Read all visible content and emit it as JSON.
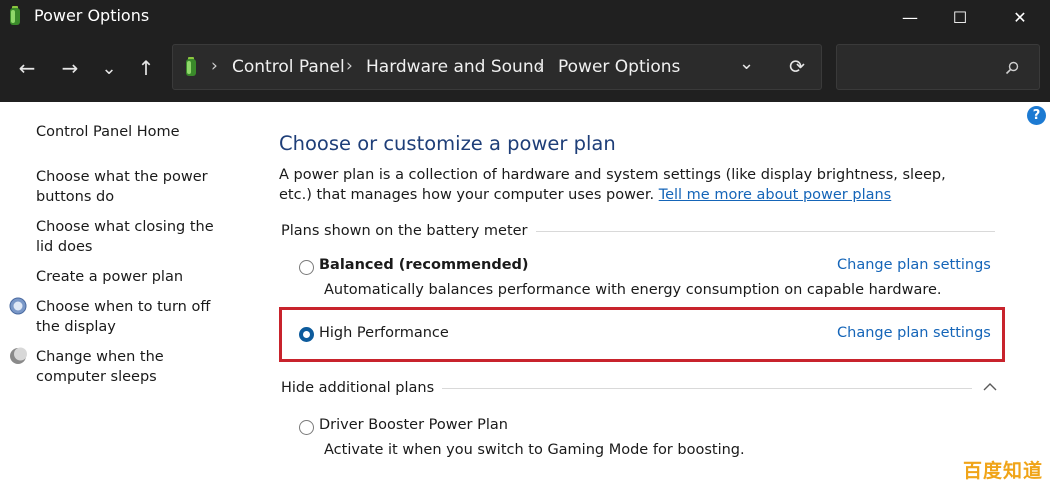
{
  "window": {
    "title": "Power Options",
    "minimize_glyph": "—",
    "maximize_glyph": "☐",
    "close_glyph": "✕"
  },
  "nav": {
    "back_glyph": "←",
    "forward_glyph": "→",
    "recent_glyph": "⌄",
    "up_glyph": "↑",
    "breadcrumbs": [
      "Control Panel",
      "Hardware and Sound",
      "Power Options"
    ],
    "separator": "›",
    "dropdown_glyph": "⌄",
    "refresh_glyph": "⟳",
    "search_placeholder": "",
    "search_icon": "search-icon"
  },
  "sidebar": {
    "items": [
      {
        "label": "Control Panel Home",
        "icon": ""
      },
      {
        "label": "Choose what the power buttons do",
        "icon": ""
      },
      {
        "label": "Choose what closing the lid does",
        "icon": ""
      },
      {
        "label": "Create a power plan",
        "icon": ""
      },
      {
        "label": "Choose when to turn off the display",
        "icon": "monitor-icon"
      },
      {
        "label": "Change when the computer sleeps",
        "icon": "moon-icon"
      }
    ]
  },
  "main": {
    "help_glyph": "?",
    "heading": "Choose or customize a power plan",
    "description": "A power plan is a collection of hardware and system settings (like display brightness, sleep, etc.) that manages how your computer uses power.",
    "learn_more": "Tell me more about power plans",
    "group_label": "Plans shown on the battery meter",
    "plans": [
      {
        "name": "Balanced (recommended)",
        "description": "Automatically balances performance with energy consumption on capable hardware.",
        "selected": false,
        "link": "Change plan settings"
      },
      {
        "name": "High Performance",
        "description": "",
        "selected": true,
        "link": "Change plan settings"
      }
    ],
    "hidden_label": "Hide additional plans",
    "hidden_plans": [
      {
        "name": "Driver Booster Power Plan",
        "description": "Activate it when you switch to Gaming Mode for boosting.",
        "selected": false
      }
    ]
  },
  "watermark": "百度知道",
  "colors": {
    "chrome": "#202020",
    "link": "#1565b8",
    "heading": "#1e3e78",
    "highlight_box": "#c8232c",
    "selected_radio": "#0d5b9c"
  }
}
